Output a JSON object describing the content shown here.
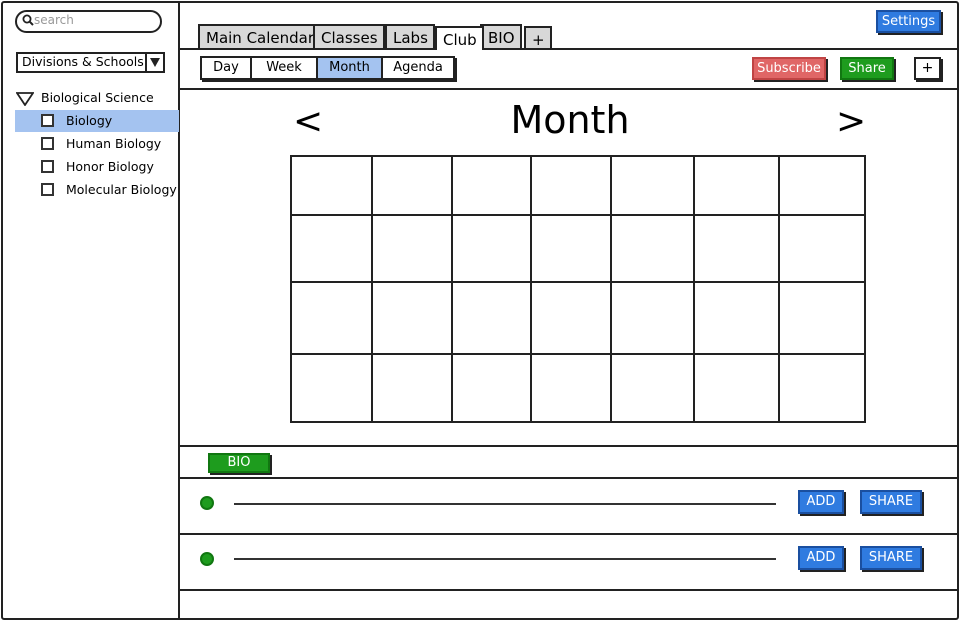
{
  "sidebar": {
    "search_placeholder": "search",
    "division_select": "Divisions & Schools",
    "tree": {
      "root": "Biological Science",
      "items": [
        {
          "label": "Biology",
          "selected": true
        },
        {
          "label": "Human Biology",
          "selected": false
        },
        {
          "label": "Honor Biology",
          "selected": false
        },
        {
          "label": "Molecular Biology",
          "selected": false
        }
      ]
    }
  },
  "tabs": [
    "Main Calendar",
    "Classes",
    "Labs",
    "Club",
    "BIO",
    "+"
  ],
  "active_tab": "Club",
  "header": {
    "settings_label": "Settings"
  },
  "views": {
    "items": [
      "Day",
      "Week",
      "Month",
      "Agenda"
    ],
    "active": "Month"
  },
  "actions": {
    "subscribe_label": "Subscribe",
    "share_label": "Share",
    "add_label": "+"
  },
  "calendar": {
    "prev_label": "<",
    "title": "Month",
    "next_label": ">",
    "rows": 4,
    "cols": 7
  },
  "bottom": {
    "tag_label": "BIO",
    "rows": [
      {
        "add_label": "ADD",
        "share_label": "SHARE"
      },
      {
        "add_label": "ADD",
        "share_label": "SHARE"
      }
    ]
  },
  "colors": {
    "accent_blue": "#2f7be0",
    "selection": "#a4c3f0",
    "green": "#1e9c1e",
    "red": "#e06666"
  }
}
